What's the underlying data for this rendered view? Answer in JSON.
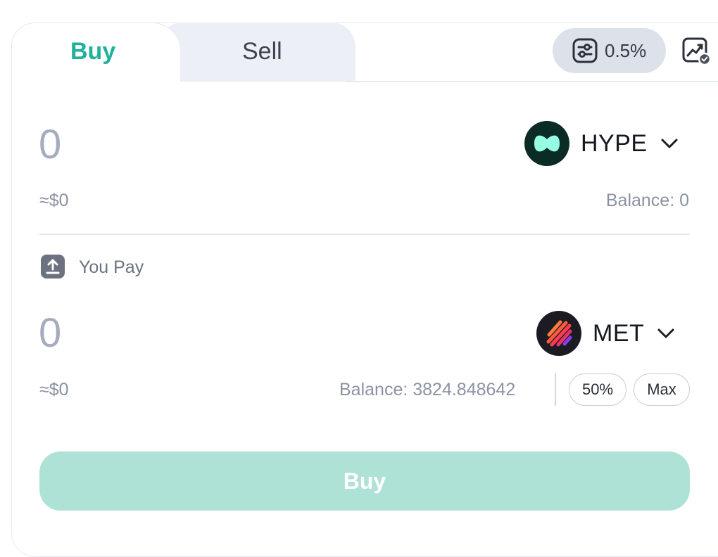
{
  "tabs": {
    "buy_label": "Buy",
    "sell_label": "Sell"
  },
  "slippage": {
    "value": "0.5%"
  },
  "receive": {
    "amount": "0",
    "usd": "≈$0",
    "token": "HYPE",
    "balance": "Balance: 0"
  },
  "pay": {
    "label": "You Pay",
    "amount": "0",
    "usd": "≈$0",
    "token": "MET",
    "balance": "Balance: 3824.848642",
    "half_label": "50%",
    "max_label": "Max"
  },
  "action": {
    "label": "Buy"
  },
  "colors": {
    "accent": "#1fb19a",
    "button_disabled": "#aee2d6",
    "hype_logo_bg": "#0b2b26",
    "hype_logo_fg": "#97fce4",
    "met_logo_bg": "#1b1b24",
    "met_logo_fg": "#ff5a3c"
  },
  "icons": {
    "slippage": "sliders-icon",
    "chart": "chart-check-icon",
    "pay": "upload-icon",
    "chevron": "chevron-down-icon"
  }
}
